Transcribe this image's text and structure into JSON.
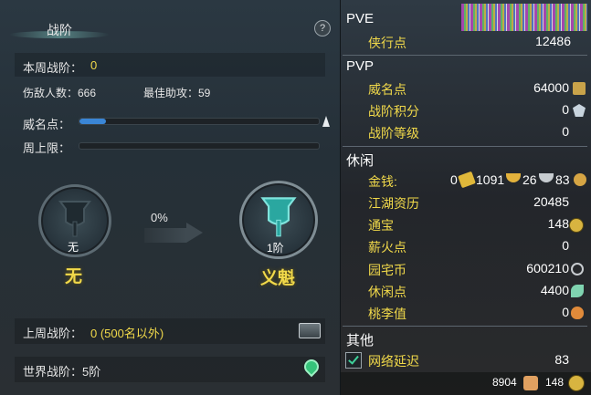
{
  "left_panel": {
    "title": "战阶",
    "weekly_rank_label": "本周战阶：",
    "weekly_rank_value": "0",
    "kills_text": "伤敌人数：666",
    "assists_text": "最佳助攻：59",
    "prestige_label": "威名点：",
    "prestige_progress": 0.11,
    "weekly_cap_label": "周上限：",
    "weekly_cap_progress": 0,
    "percent": "0%",
    "current_tier": {
      "badge": "无",
      "name": "无"
    },
    "next_tier": {
      "badge": "1阶",
      "name": "义魁"
    },
    "last_week_label": "上周战阶：",
    "last_week_value": "0 (500名以外)",
    "world_rank_text": "世界战阶：5阶"
  },
  "right_panel": {
    "pve": {
      "header": "PVE",
      "items": [
        {
          "label": "侠行点",
          "value": "12486"
        }
      ]
    },
    "pvp": {
      "header": "PVP",
      "items": [
        {
          "label": "威名点",
          "value": "64000"
        },
        {
          "label": "战阶积分",
          "value": "0"
        },
        {
          "label": "战阶等级",
          "value": "0"
        }
      ]
    },
    "leisure": {
      "header": "休闲",
      "money_label": "金钱:",
      "money": [
        "0",
        "1091",
        "26",
        "83"
      ],
      "items": [
        {
          "label": "江湖资历",
          "value": "20485"
        },
        {
          "label": "通宝",
          "value": "148"
        },
        {
          "label": "薪火点",
          "value": "0"
        },
        {
          "label": "园宅币",
          "value": "600210"
        },
        {
          "label": "休闲点",
          "value": "4400"
        },
        {
          "label": "桃李值",
          "value": "0"
        }
      ]
    },
    "other": {
      "header": "其他",
      "latency_label": "网络延迟",
      "latency_value": "83",
      "latency_checked": true
    },
    "footer": {
      "left_value": "8904",
      "right_value": "148"
    }
  },
  "colors": {
    "gold": "#f1d94a",
    "progress_blue": "#3a86d6",
    "panel": "#25303a"
  },
  "icons": [
    "help-icon",
    "chest-icon",
    "location-pin-icon",
    "checkbox-icon",
    "coin-icon"
  ]
}
